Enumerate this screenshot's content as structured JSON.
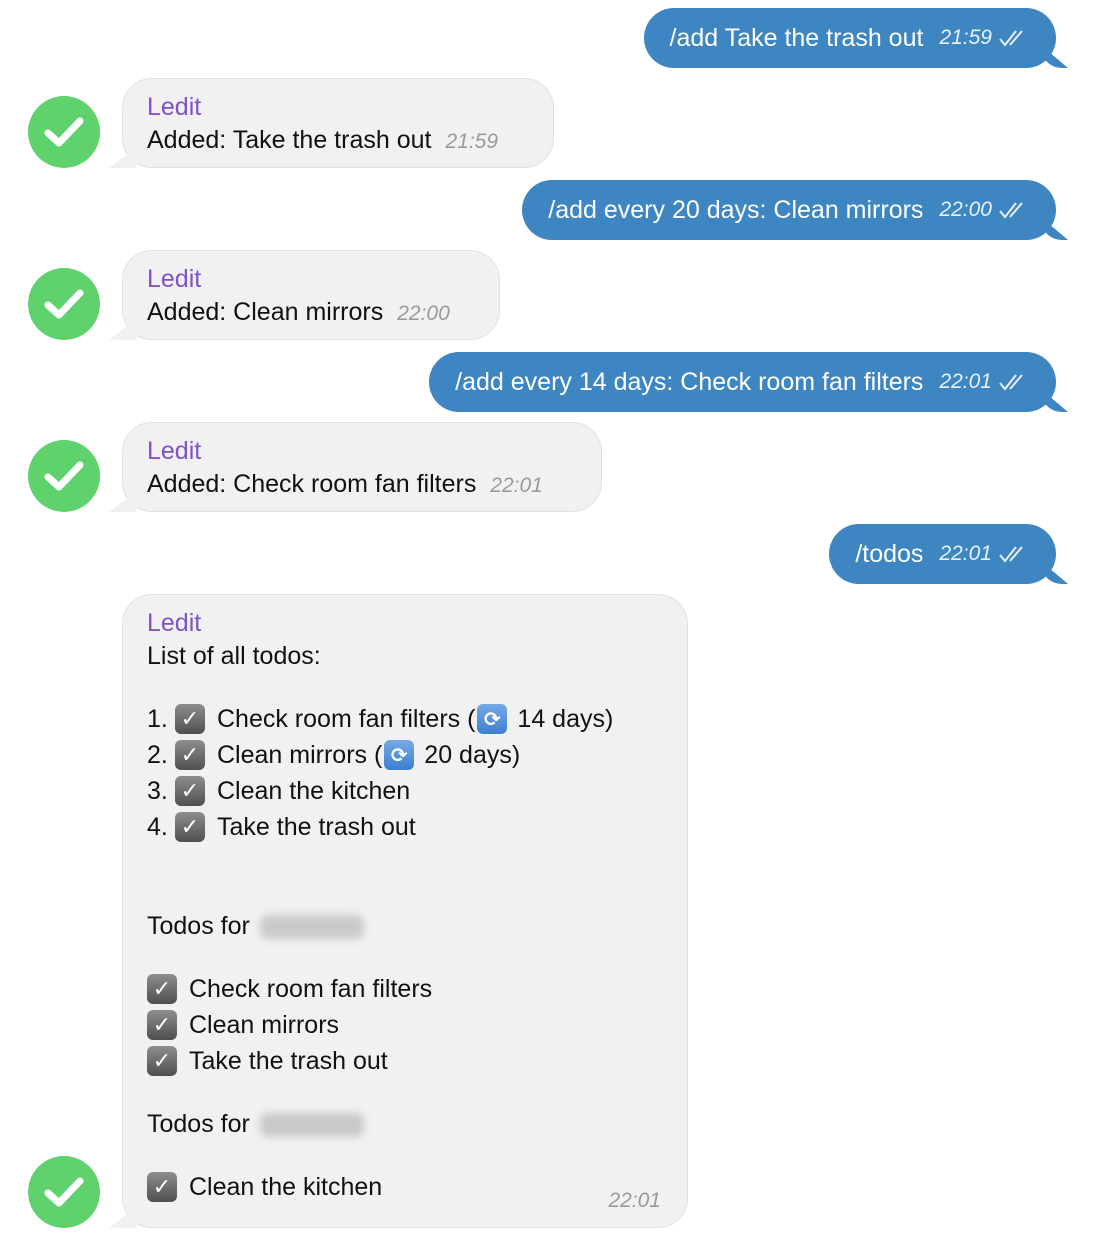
{
  "messages": {
    "out1": {
      "text": "/add Take the trash out",
      "time": "21:59"
    },
    "in1": {
      "sender": "Ledit",
      "text": "Added: Take the trash out",
      "time": "21:59"
    },
    "out2": {
      "text": "/add every 20 days: Clean mirrors",
      "time": "22:00"
    },
    "in2": {
      "sender": "Ledit",
      "text": "Added: Clean mirrors",
      "time": "22:00"
    },
    "out3": {
      "text": "/add every 14 days: Check room fan filters",
      "time": "22:01"
    },
    "in3": {
      "sender": "Ledit",
      "text": "Added: Check room fan filters",
      "time": "22:01"
    },
    "out4": {
      "text": "/todos",
      "time": "22:01"
    },
    "in4": {
      "sender": "Ledit",
      "heading": "List of all todos:",
      "list": [
        {
          "num": "1.",
          "text": "Check room fan filters (",
          "repeat": "14 days)"
        },
        {
          "num": "2.",
          "text": "Clean mirrors (",
          "repeat": "20 days)"
        },
        {
          "num": "3.",
          "text": "Clean the kitchen"
        },
        {
          "num": "4.",
          "text": "Take the trash out"
        }
      ],
      "group1_label": "Todos for",
      "group1_items": [
        "Check room fan filters",
        "Clean mirrors",
        "Take the trash out"
      ],
      "group2_label": "Todos for",
      "group2_items": [
        "Clean the kitchen"
      ],
      "time": "22:01"
    }
  },
  "colors": {
    "outgoing": "#3d86c2",
    "incoming": "#f1f1f1",
    "sender": "#8152c9",
    "avatar": "#5fd26e"
  },
  "icons": {
    "avatar": "checkmark-icon",
    "ticks": "double-check-icon",
    "checkbox": "checked-box-icon",
    "repeat": "repeat-icon"
  }
}
